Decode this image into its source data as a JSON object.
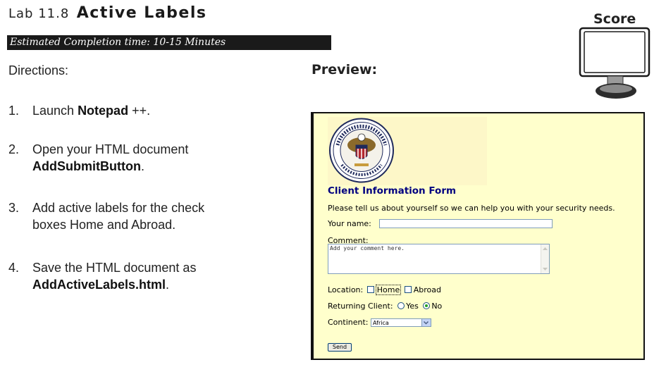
{
  "header": {
    "lab_number": "Lab 11.8",
    "lab_name": "Active Labels",
    "estimated_time": "Estimated Completion time: 10-15 Minutes"
  },
  "directions": {
    "heading": "Directions:",
    "steps": [
      {
        "num": "1.",
        "pre": "Launch ",
        "bold": "Notepad",
        "post": " ++."
      },
      {
        "num": "2.",
        "line1": "Open your HTML document",
        "bold": "AddSubmitButton",
        "post": "."
      },
      {
        "num": "3.",
        "line1": "Add active labels for the check",
        "line2": "boxes Home and Abroad."
      },
      {
        "num": "4.",
        "line1": "Save the HTML document as",
        "bold": "AddActiveLabels.html",
        "post": "."
      }
    ]
  },
  "preview": {
    "heading": "Preview:"
  },
  "score": {
    "label": "Score"
  },
  "form": {
    "title": "Client Information Form",
    "intro": "Please tell us about yourself so we can help you with your security needs.",
    "name_label": "Your name:",
    "comment_label": "Comment:",
    "comment_placeholder": "Add your comment here.",
    "location_label": "Location:",
    "location_home": "Home",
    "location_abroad": "Abroad",
    "returning_label": "Returning Client:",
    "returning_yes": "Yes",
    "returning_no": "No",
    "returning_selected": "No",
    "continent_label": "Continent:",
    "continent_value": "Africa",
    "send_label": "Send"
  },
  "colors": {
    "preview_background": "#ffffcc",
    "form_title": "#000080",
    "time_bar": "#1a1a1a"
  }
}
